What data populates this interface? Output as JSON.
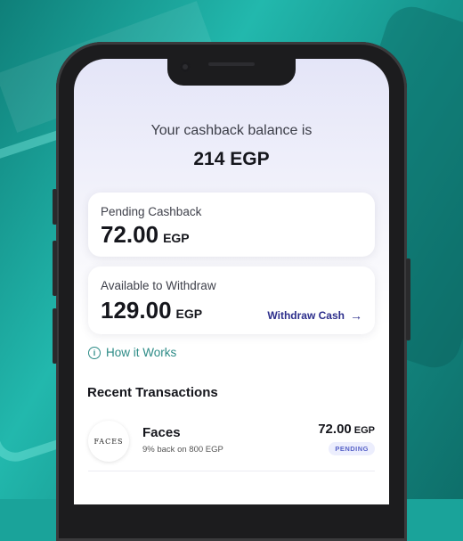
{
  "balance": {
    "label": "Your cashback balance is",
    "value": "214 EGP"
  },
  "pending": {
    "label": "Pending Cashback",
    "amount": "72.00",
    "currency": "EGP"
  },
  "available": {
    "label": "Available to Withdraw",
    "amount": "129.00",
    "currency": "EGP",
    "action_label": "Withdraw Cash",
    "action_icon": "arrow-right-icon"
  },
  "how_it_works": {
    "label": "How it Works",
    "icon": "info-icon"
  },
  "recent": {
    "title": "Recent Transactions"
  },
  "transactions": [
    {
      "logo_text": "FACES",
      "name": "Faces",
      "subtitle": "9% back on 800 EGP",
      "amount": "72.00",
      "currency": "EGP",
      "status": "PENDING"
    }
  ],
  "colors": {
    "accent": "#2d2f8c",
    "teal": "#2c8b86",
    "badge_bg": "#eceefd",
    "badge_text": "#5863c8"
  }
}
